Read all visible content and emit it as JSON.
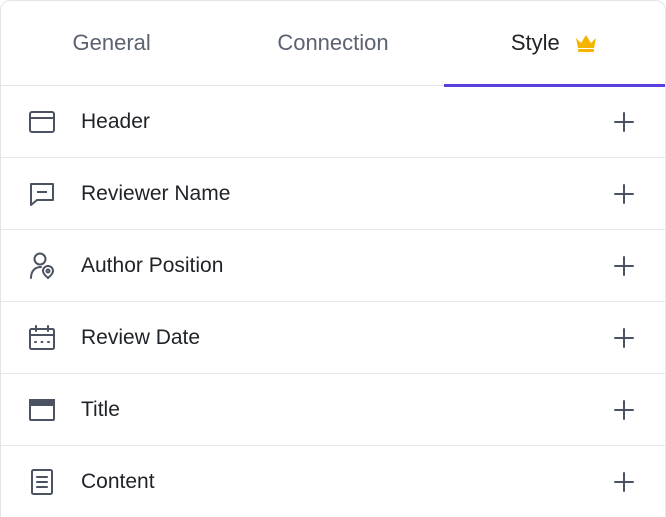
{
  "tabs": [
    {
      "label": "General",
      "active": false
    },
    {
      "label": "Connection",
      "active": false
    },
    {
      "label": "Style",
      "active": true,
      "icon": "crown-icon"
    }
  ],
  "colors": {
    "accent": "#5b3ee0",
    "crown": "#f5b400",
    "icon": "#4b5261",
    "divider": "#e6e7ea"
  },
  "items": [
    {
      "label": "Header",
      "icon": "header-layout-icon"
    },
    {
      "label": "Reviewer Name",
      "icon": "message-icon"
    },
    {
      "label": "Author Position",
      "icon": "user-location-icon"
    },
    {
      "label": "Review Date",
      "icon": "calendar-icon"
    },
    {
      "label": "Title",
      "icon": "title-window-icon"
    },
    {
      "label": "Content",
      "icon": "document-icon"
    }
  ]
}
